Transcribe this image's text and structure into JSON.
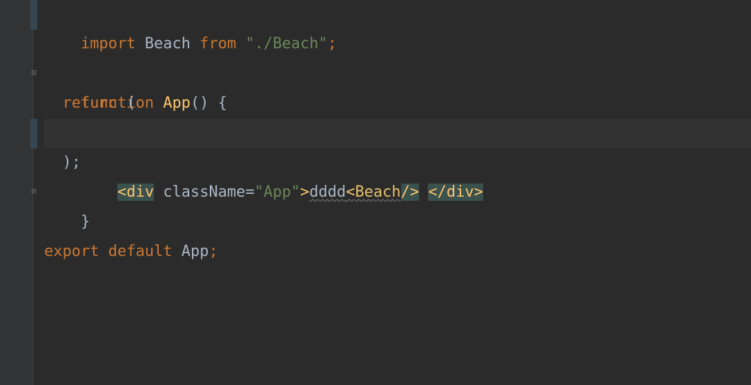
{
  "code": {
    "line1": {
      "kw_import": "import",
      "ident": "Beach",
      "kw_from": "from",
      "str": "\"./Beach\"",
      "semi": ";"
    },
    "line3": {
      "kw_function": "function",
      "func_name": "App",
      "parens_brace": "() {"
    },
    "line4": {
      "kw_return": "return",
      "paren": " ("
    },
    "line5": {
      "open_angle": "<",
      "tag_div": "div",
      "attr_space": " ",
      "attr_name": "className",
      "equals": "=",
      "attr_value": "\"App\"",
      "close_angle": ">",
      "text_dddd": "dddd",
      "open_angle2": "<",
      "comp_beach": "Beach",
      "slash": "/",
      "close_angle2": ">",
      "space": " ",
      "close_open_angle": "</",
      "tag_div2": "div",
      "close_angle3": ">"
    },
    "line6": {
      "close": ");"
    },
    "line7": {
      "brace": "}"
    },
    "line9": {
      "kw_export": "export",
      "kw_default": "default",
      "ident": "App",
      "semi": ";"
    }
  }
}
